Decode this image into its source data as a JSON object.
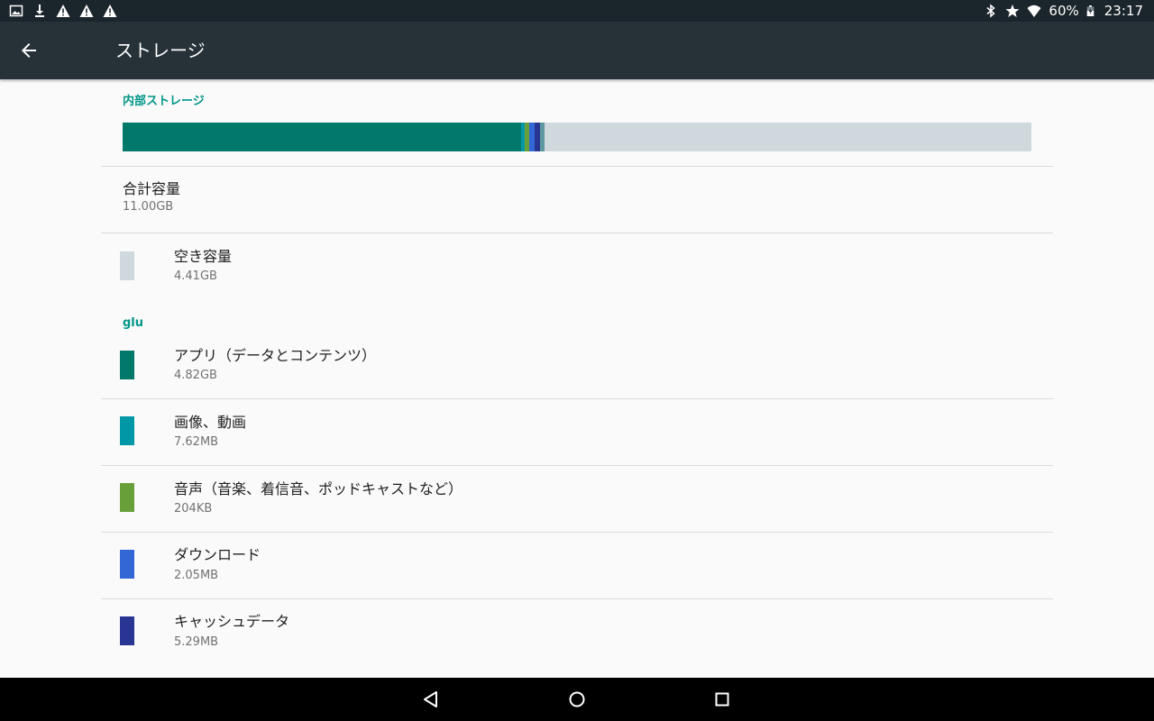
{
  "status_bar": {
    "left_icons": [
      "image-icon",
      "download-icon",
      "warning-icon",
      "warning-icon",
      "warning-icon"
    ],
    "right_icons": [
      "bluetooth-icon",
      "star-icon",
      "wifi-icon",
      "battery-charging-icon"
    ],
    "battery": "60%",
    "time": "23:17"
  },
  "app_bar": {
    "title": "ストレージ",
    "background": "#263238"
  },
  "internal_storage": {
    "header": "内部ストレージ",
    "bar_segments": [
      {
        "name": "apps",
        "fraction": 0.4382,
        "color": "#00796b"
      },
      {
        "name": "images",
        "fraction": 0.0045,
        "color": "#0097a7"
      },
      {
        "name": "audio",
        "fraction": 0.005,
        "color": "#689f38"
      },
      {
        "name": "downloads",
        "fraction": 0.006,
        "color": "#3367d6"
      },
      {
        "name": "cache",
        "fraction": 0.006,
        "color": "#283593"
      },
      {
        "name": "misc",
        "fraction": 0.0045,
        "color": "#5e97a0"
      }
    ],
    "bar_background": "#cfd8dc",
    "total": {
      "label": "合計容量",
      "value": "11.00GB"
    },
    "free": {
      "label": "空き容量",
      "value": "4.41GB",
      "color": "#cfd8dc"
    }
  },
  "user_section": {
    "header": "glu",
    "items": [
      {
        "label": "アプリ（データとコンテンツ）",
        "value": "4.82GB",
        "color": "#00796b"
      },
      {
        "label": "画像、動画",
        "value": "7.62MB",
        "color": "#0097a7"
      },
      {
        "label": "音声（音楽、着信音、ポッドキャストなど）",
        "value": "204KB",
        "color": "#689f38"
      },
      {
        "label": "ダウンロード",
        "value": "2.05MB",
        "color": "#3367d6"
      },
      {
        "label": "キャッシュデータ",
        "value": "5.29MB",
        "color": "#283593"
      }
    ]
  },
  "nav_bar": {
    "buttons": [
      "back-triangle-icon",
      "home-circle-icon",
      "recents-square-icon"
    ]
  }
}
